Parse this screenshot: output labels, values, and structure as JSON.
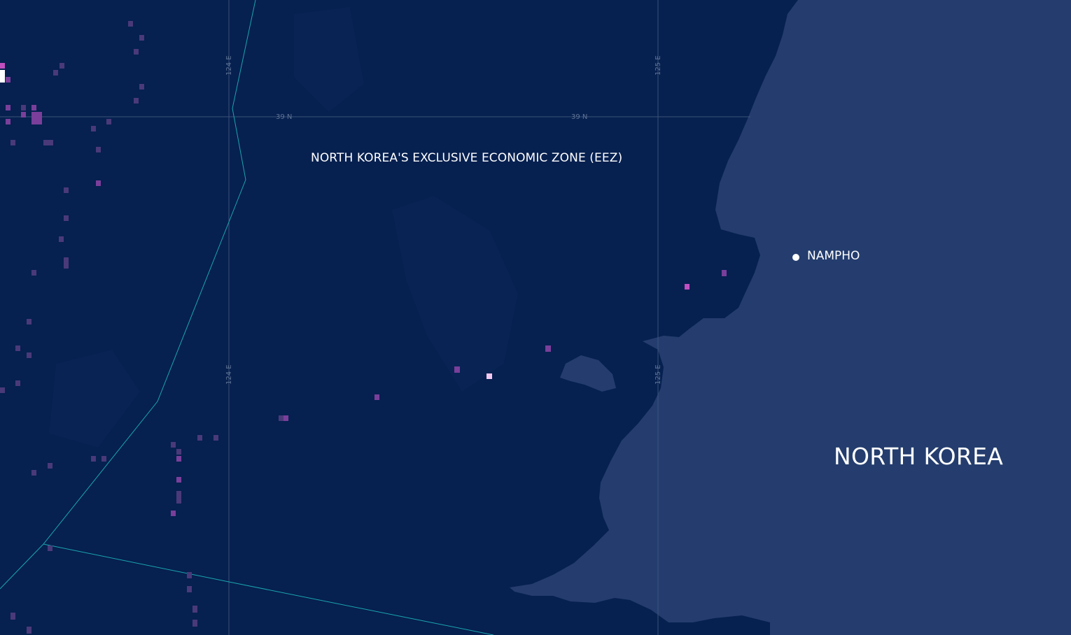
{
  "map": {
    "eez_label": "NORTH KOREA'S EXCLUSIVE ECONOMIC ZONE (EEZ)",
    "city": {
      "name": "NAMPHO"
    },
    "country_label": "NORTH KOREA",
    "graticule": {
      "meridians": [
        {
          "label": "124 E"
        },
        {
          "label": "125 E"
        }
      ],
      "parallels": [
        {
          "label": "39 N"
        }
      ]
    },
    "colors": {
      "sea": "#062050",
      "land": "#243d6e",
      "eez_boundary": "#1aa5ad",
      "grid": "#3b5378",
      "activity_low": "#4a3a7a",
      "activity_mid": "#7a3f9a",
      "activity_high": "#c14fc0",
      "activity_peak": "#ffffff"
    }
  }
}
